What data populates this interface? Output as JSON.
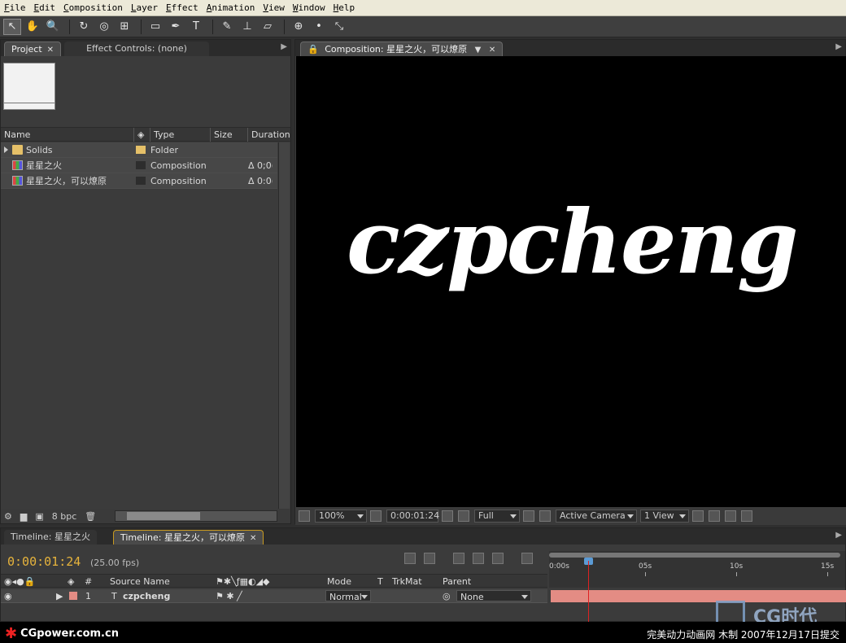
{
  "menu": [
    "File",
    "Edit",
    "Composition",
    "Layer",
    "Effect",
    "Animation",
    "View",
    "Window",
    "Help"
  ],
  "tools": [
    {
      "name": "selection-tool-icon",
      "glyph": "↖"
    },
    {
      "name": "hand-tool-icon",
      "glyph": "✋"
    },
    {
      "name": "zoom-tool-icon",
      "glyph": "🔍"
    },
    {
      "name": "rotate-tool-icon",
      "glyph": "↻"
    },
    {
      "name": "orbit-camera-icon",
      "glyph": "◎"
    },
    {
      "name": "pan-behind-icon",
      "glyph": "⊞"
    },
    {
      "name": "rectangle-mask-icon",
      "glyph": "▭"
    },
    {
      "name": "pen-tool-icon",
      "glyph": "✒"
    },
    {
      "name": "type-tool-icon",
      "glyph": "T"
    },
    {
      "name": "brush-tool-icon",
      "glyph": "✎"
    },
    {
      "name": "clone-stamp-icon",
      "glyph": "⊥"
    },
    {
      "name": "eraser-tool-icon",
      "glyph": "▱"
    }
  ],
  "project": {
    "tab_project": "Project",
    "tab_effect": "Effect Controls: (none)",
    "columns": {
      "name": "Name",
      "type": "Type",
      "size": "Size",
      "duration": "Duration"
    },
    "items": [
      {
        "name": "Solids",
        "type": "Folder",
        "duration": "",
        "label_color": "#e5c068",
        "kind": "folder"
      },
      {
        "name": "星星之火",
        "type": "Composition",
        "duration": "Δ 0;0(",
        "label_color": "#2d2d2d",
        "kind": "comp"
      },
      {
        "name": "星星之火，可以燎原",
        "type": "Composition",
        "duration": "Δ 0:0(",
        "label_color": "#2d2d2d",
        "kind": "comp"
      }
    ],
    "bpc": "8 bpc"
  },
  "composition": {
    "tab_title": "Composition: 星星之火，可以燎原",
    "text": "czpcheng",
    "zoom": "100%",
    "timecode": "0:00:01:24",
    "resolution": "Full",
    "camera": "Active Camera",
    "views": "1 View"
  },
  "timeline": {
    "tab1": "Timeline: 星星之火",
    "tab2": "Timeline: 星星之火，可以燎原",
    "current_time": "0:00:01:24",
    "fps": "(25.00 fps)",
    "columns": {
      "number": "#",
      "source_name": "Source Name",
      "mode": "Mode",
      "t": "T",
      "trkmat": "TrkMat",
      "parent": "Parent"
    },
    "ruler_labels": [
      "0:00s",
      "05s",
      "10s",
      "15s"
    ],
    "layer": {
      "index": "1",
      "type_glyph": "T",
      "name": "czpcheng",
      "mode": "Normal",
      "parent": "None",
      "label_color": "#e38c84"
    }
  },
  "footer": {
    "site": "CGpower.com.cn",
    "credit": "完美动力动画网 木制 2007年12月17日提交",
    "watermark": "CG时代"
  },
  "colors": {
    "accent_time": "#e6b33c",
    "playhead": "#d22222",
    "layer_bar": "#e38c84"
  }
}
